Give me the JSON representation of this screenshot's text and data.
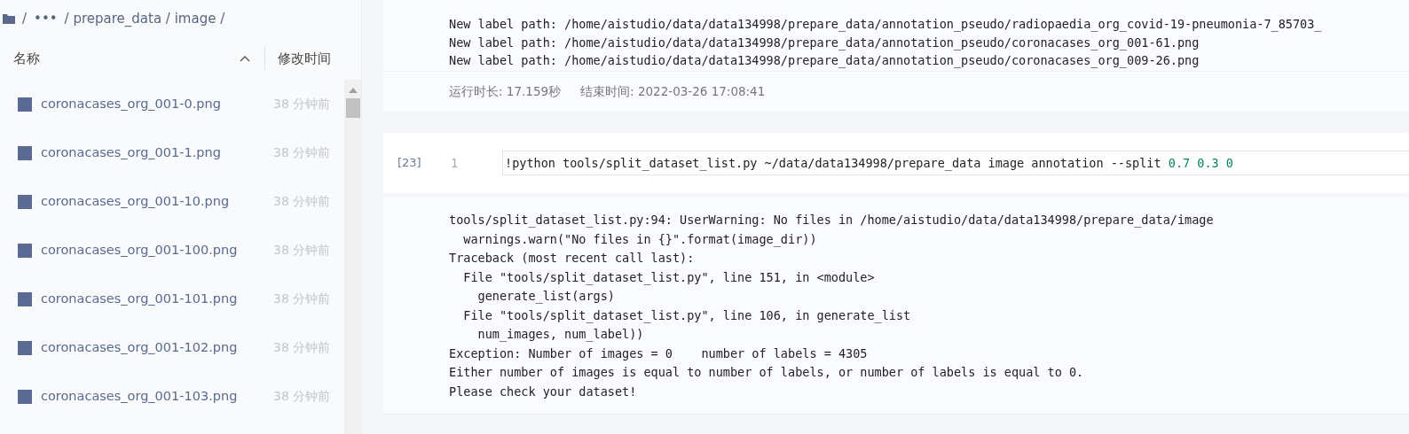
{
  "sidebar": {
    "breadcrumb": [
      "/",
      "•••",
      "/ prepare_data / image /"
    ],
    "columns": [
      {
        "label": "名称",
        "sorted": true
      },
      {
        "label": "修改时间"
      }
    ],
    "files": [
      {
        "name": "coronacases_org_001-0.png",
        "modified": "38 分钟前"
      },
      {
        "name": "coronacases_org_001-1.png",
        "modified": "38 分钟前"
      },
      {
        "name": "coronacases_org_001-10.png",
        "modified": "38 分钟前"
      },
      {
        "name": "coronacases_org_001-100.png",
        "modified": "38 分钟前"
      },
      {
        "name": "coronacases_org_001-101.png",
        "modified": "38 分钟前"
      },
      {
        "name": "coronacases_org_001-102.png",
        "modified": "38 分钟前"
      },
      {
        "name": "coronacases_org_001-103.png",
        "modified": "38 分钟前"
      }
    ]
  },
  "previous_output": {
    "lines": [
      "New label path: /home/aistudio/data/data134998/prepare_data/annotation_pseudo/radiopaedia_org_covid-19-pneumonia-7_85703_",
      "New label path: /home/aistudio/data/data134998/prepare_data/annotation_pseudo/coronacases_org_001-61.png",
      "New label path: /home/aistudio/data/data134998/prepare_data/annotation_pseudo/coronacases_org_009-26.png"
    ],
    "duration_label": "运行时长:",
    "duration": "17.159秒",
    "end_label": "结束时间:",
    "end_time": "2022-03-26 17:08:41"
  },
  "cell": {
    "prompt": "[23]",
    "line_number": "1",
    "code": [
      {
        "text": "!python tools/split_dataset_list.py ~/data/data134998/prepare_data image annotation --split",
        "kind": "plain"
      },
      {
        "text": " 0.7",
        "kind": "number"
      },
      {
        "text": " 0.3",
        "kind": "number"
      },
      {
        "text": " 0",
        "kind": "number"
      }
    ],
    "output": [
      "tools/split_dataset_list.py:94: UserWarning: No files in /home/aistudio/data/data134998/prepare_data/image",
      "  warnings.warn(\"No files in {}\".format(image_dir))",
      "Traceback (most recent call last):",
      "  File \"tools/split_dataset_list.py\", line 151, in <module>",
      "    generate_list(args)",
      "  File \"tools/split_dataset_list.py\", line 106, in generate_list",
      "    num_images, num_label))",
      "Exception: Number of images = 0    number of labels = 4305",
      "Either number of images is equal to number of labels, or number of labels is equal to 0.",
      "Please check your dataset!"
    ]
  }
}
